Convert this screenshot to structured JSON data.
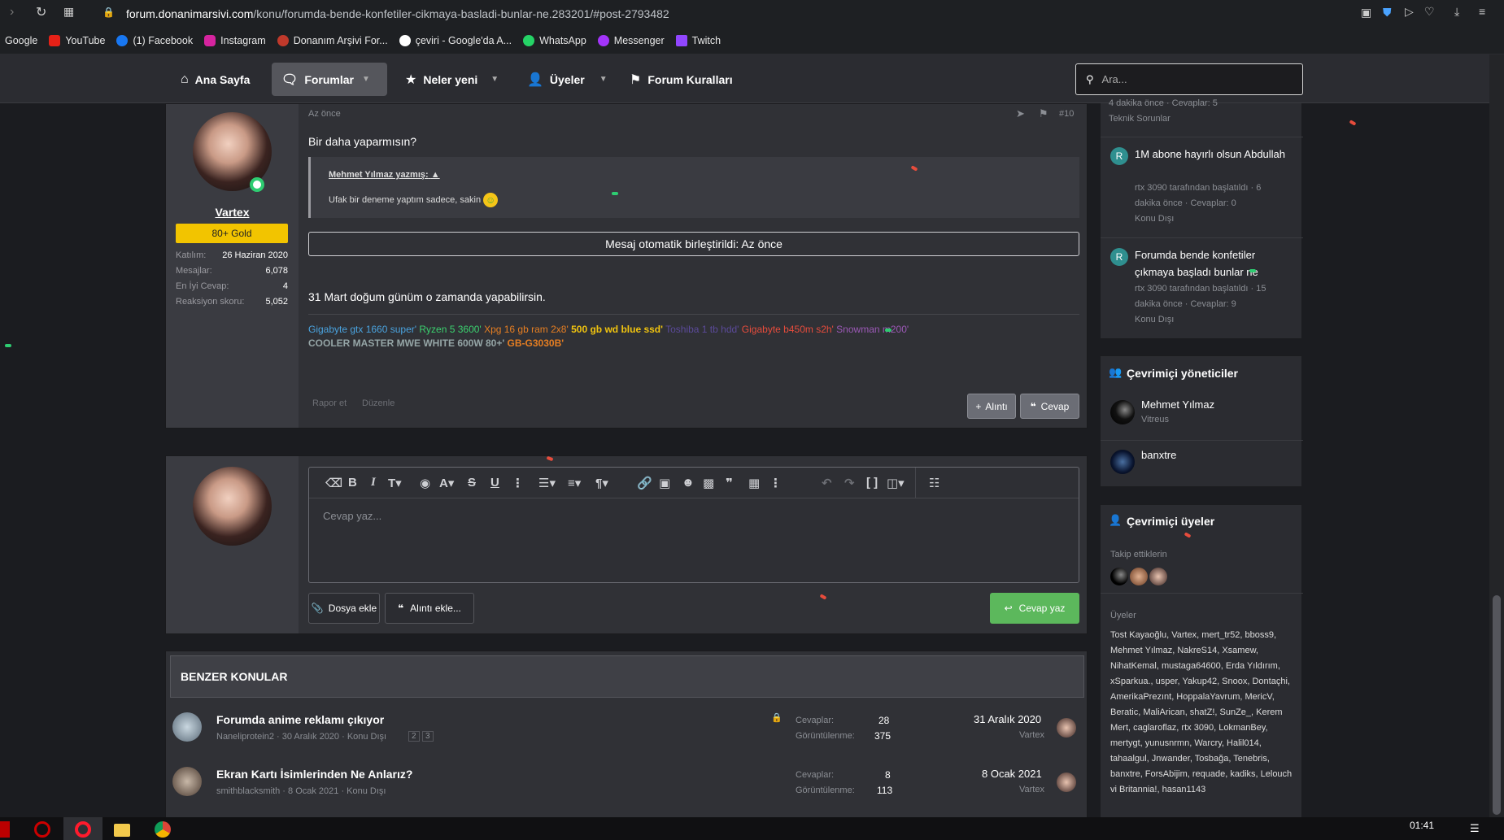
{
  "browser": {
    "url_host": "forum.donanimarsivi.com",
    "url_path": "/konu/forumda-bende-konfetiler-cikmaya-basladi-bunlar-ne.283201/#post-2793482",
    "bookmarks": [
      "Google",
      "YouTube",
      "(1) Facebook",
      "Instagram",
      "Donanım Arşivi For...",
      "çeviri - Google'da A...",
      "WhatsApp",
      "Messenger",
      "Twitch"
    ]
  },
  "nav": {
    "home": "Ana Sayfa",
    "forums": "Forumlar",
    "whats_new": "Neler yeni",
    "members": "Üyeler",
    "rules": "Forum Kuralları",
    "search_placeholder": "Ara..."
  },
  "post": {
    "time": "Az önce",
    "number": "#10",
    "username": "Vartex",
    "rank": "80+ Gold",
    "stats": [
      {
        "k": "Katılım:",
        "v": "26 Haziran 2020"
      },
      {
        "k": "Mesajlar:",
        "v": "6,078"
      },
      {
        "k": "En İyi Cevap:",
        "v": "4"
      },
      {
        "k": "Reaksiyon skoru:",
        "v": "5,052"
      }
    ],
    "text1": "Bir daha yaparmısın?",
    "quote_author": "Mehmet Yılmaz yazmış:",
    "quote_text": "Ufak bir deneme yaptım sadece, sakin",
    "merged_notice": "Mesaj otomatik birleştirildi: Az önce",
    "text2": "31 Mart doğum günüm o zamanda yapabilirsin.",
    "signature": [
      {
        "t": "Gigabyte gtx 1660 super'",
        "c": "#4aa3df"
      },
      {
        "t": " Ryzen 5 3600'",
        "c": "#3bd16f"
      },
      {
        "t": " Xpg 16 gb ram 2x8'",
        "c": "#e67e22"
      },
      {
        "t": " 500 gb wd blue ssd'",
        "c": "#f1c40f"
      },
      {
        "t": " Toshiba 1 tb hdd'",
        "c": "#5b4a9a"
      },
      {
        "t": " Gigabyte b450m s2h'",
        "c": "#e74c3c"
      },
      {
        "t": " Snowman m200'",
        "c": "#9b59b6"
      },
      {
        "t": " COOLER MASTER MWE WHITE 600W 80+'",
        "c": "#95a5a6"
      },
      {
        "t": " GB-G3030B'",
        "c": "#e67e22"
      }
    ],
    "report": "Rapor et",
    "edit": "Düzenle",
    "quote_btn": "Alıntı",
    "reply_btn": "Cevap"
  },
  "reply": {
    "placeholder": "Cevap yaz...",
    "attach": "Dosya ekle",
    "insert_quote": "Alıntı ekle...",
    "submit": "Cevap yaz"
  },
  "similar": {
    "title": "BENZER KONULAR",
    "rows": [
      {
        "title": "Forumda anime reklamı çıkıyor",
        "meta": "Naneliprotein2 · 30 Aralık 2020 · Konu Dışı",
        "pages": [
          "2",
          "3"
        ],
        "replies_label": "Cevaplar:",
        "replies": "28",
        "views_label": "Görüntülenme:",
        "views": "375",
        "date": "31 Aralık 2020",
        "last": "Vartex"
      },
      {
        "title": "Ekran Kartı İsimlerinden Ne Anlarız?",
        "meta": "smithblacksmith · 8 Ocak 2021 · Konu Dışı",
        "pages": [],
        "replies_label": "Cevaplar:",
        "replies": "8",
        "views_label": "Görüntülenme:",
        "views": "113",
        "date": "8 Ocak 2021",
        "last": "Vartex"
      }
    ]
  },
  "sidebar": {
    "latest": [
      {
        "meta1": "4 dakika önce · Cevaplar: 5",
        "meta2": "Teknik Sorunlar"
      },
      {
        "title": "1M abone hayırlı olsun Abdullah",
        "meta1": "rtx 3090 tarafından başlatıldı · 6",
        "meta2": "dakika önce · Cevaplar: 0",
        "meta3": "Konu Dışı"
      },
      {
        "title": "Forumda bende konfetiler çıkmaya başladı bunlar ne",
        "meta1": "rtx 3090 tarafından başlatıldı · 15",
        "meta2": "dakika önce · Cevaplar: 9",
        "meta3": "Konu Dışı"
      }
    ],
    "staff_title": "Çevrimiçi yöneticiler",
    "staff": [
      {
        "name": "Mehmet Yılmaz",
        "role": "Vitreus"
      },
      {
        "name": "banxtre",
        "role": ""
      }
    ],
    "online_title": "Çevrimiçi üyeler",
    "following": "Takip ettiklerin",
    "members_label": "Üyeler",
    "members_text": "Tost Kayaoğlu, Vartex, mert_tr52, bboss9, Mehmet Yılmaz, NakreS14, Xsamew, NihatKemal, mustaga64600, Erda Yıldırım, xSparkua., usper, Yakup42, Snoox, Dontaçhi, AmerikaPrezınt, HoppalaYavrum, MericV, Beratic, MaliArican, shatZ!, SunZe_, Kerem Mert, caglaroflaz, rtx 3090, LokmanBey, mertygt, yunusnrmn, Warcry, Halil014, tahaalgul, Jnwander, Tosbağa, Tenebris, banxtre, ForsAbijim, requade, kadiks, Lelouch vi Britannia!, hasan1143"
  },
  "taskbar": {
    "time": "01:41"
  }
}
